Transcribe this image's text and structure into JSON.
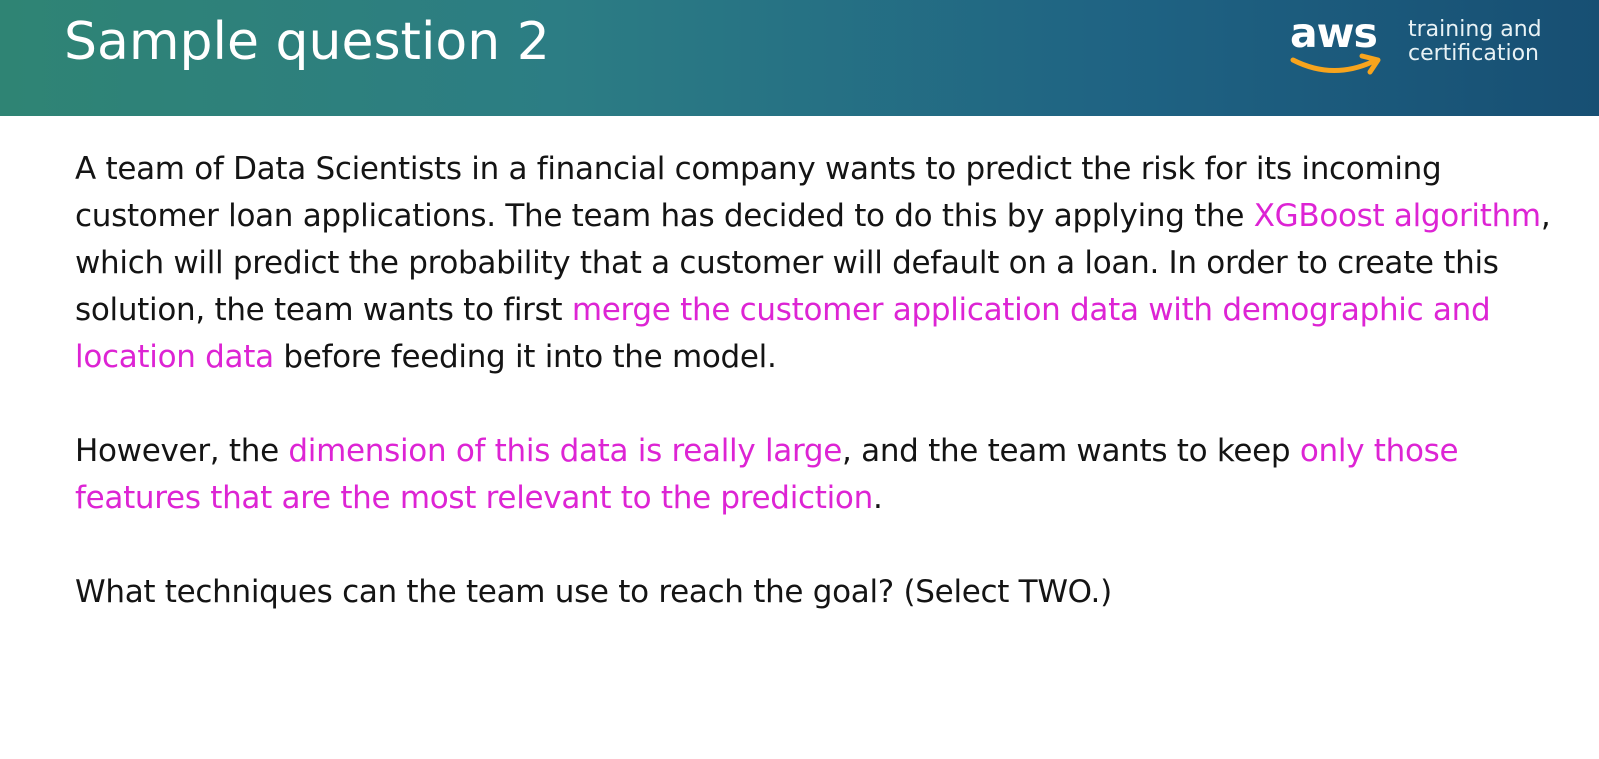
{
  "slide": {
    "title": "Sample question 2"
  },
  "branding": {
    "logo_text": "aws",
    "tagline_line1": "training and",
    "tagline_line2": "certification"
  },
  "colors": {
    "highlight": "#dd24d4",
    "body_text": "#141414",
    "header_start": "#2f8474",
    "header_end": "#174f73",
    "smile": "#f7a41d"
  },
  "question": {
    "p1": {
      "t1": "A team of Data Scientists in a financial company wants to predict the risk for its incoming customer loan applications. The team has decided to do this by applying the ",
      "h1": "XGBoost algorithm",
      "t2": ", which will predict the probability that a customer will default on a loan. In order to create this solution, the team wants to first ",
      "h2": "merge the customer application data with demographic and location data",
      "t3": " before feeding it into the model."
    },
    "p2": {
      "t1": "However, the ",
      "h1": "dimension of this data is really large",
      "t2": ", and the team wants to keep ",
      "h2": "only those features that are the most relevant to the prediction",
      "t3": "."
    },
    "p3": {
      "t1": "What techniques can the team use to reach the goal? (Select TWO.)"
    }
  }
}
